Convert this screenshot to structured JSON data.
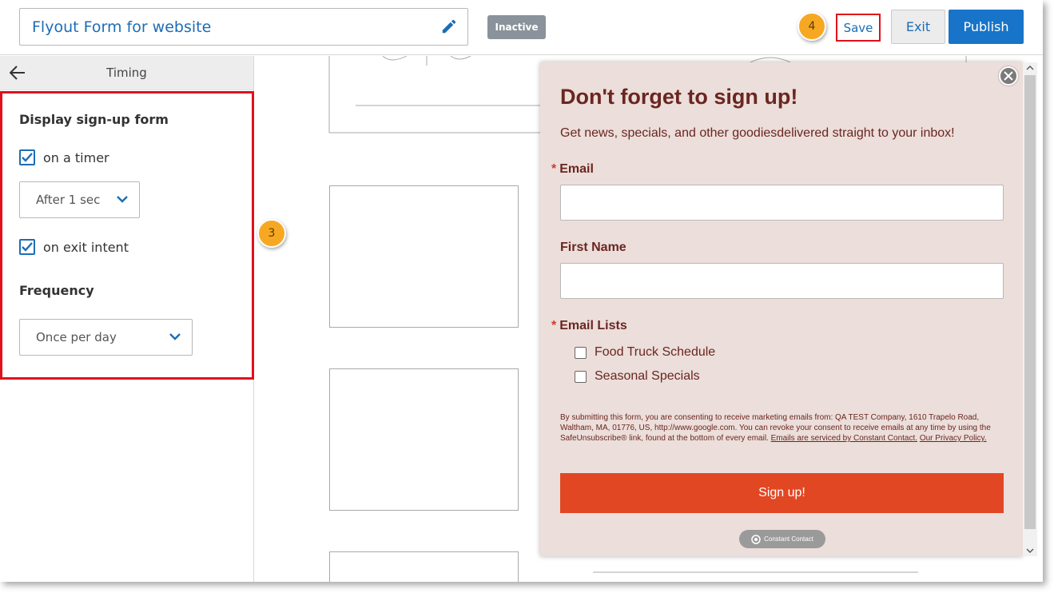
{
  "header": {
    "form_title": "Flyout Form for website",
    "status": "Inactive",
    "save_label": "Save",
    "exit_label": "Exit",
    "publish_label": "Publish"
  },
  "steps": {
    "step3": "3",
    "step4": "4"
  },
  "sidebar": {
    "title": "Timing",
    "display_heading": "Display sign-up form",
    "timer_label": "on a timer",
    "timer_checked": true,
    "timer_value": "After 1 sec",
    "exit_intent_label": "on exit intent",
    "exit_intent_checked": true,
    "frequency_heading": "Frequency",
    "frequency_value": "Once per day"
  },
  "flyout": {
    "title": "Don't forget to sign up!",
    "subtitle": "Get news, specials, and other goodiesdelivered straight to your inbox!",
    "email_label": "Email",
    "first_name_label": "First Name",
    "lists_label": "Email Lists",
    "required_mark": "*",
    "lists": [
      "Food Truck Schedule",
      "Seasonal Specials"
    ],
    "legal_text": "By submitting this form, you are consenting to receive marketing emails from: QA TEST Company, 1610 Trapelo Road, Waltham, MA, 01776, US, http://www.google.com. You can revoke your consent to receive emails at any time by using the SafeUnsubscribe® link, found at the bottom of every email.",
    "legal_link1": "Emails are serviced by Constant Contact.",
    "legal_link2": "Our Privacy Policy.",
    "signup_label": "Sign up!",
    "badge": "Constant Contact"
  },
  "colors": {
    "accent": "#1874c8",
    "highlight": "#e0111b",
    "step_bubble": "#f7a823",
    "flyout_bg": "#ecdeda",
    "flyout_text": "#6a2621",
    "signup_button": "#e24724"
  }
}
